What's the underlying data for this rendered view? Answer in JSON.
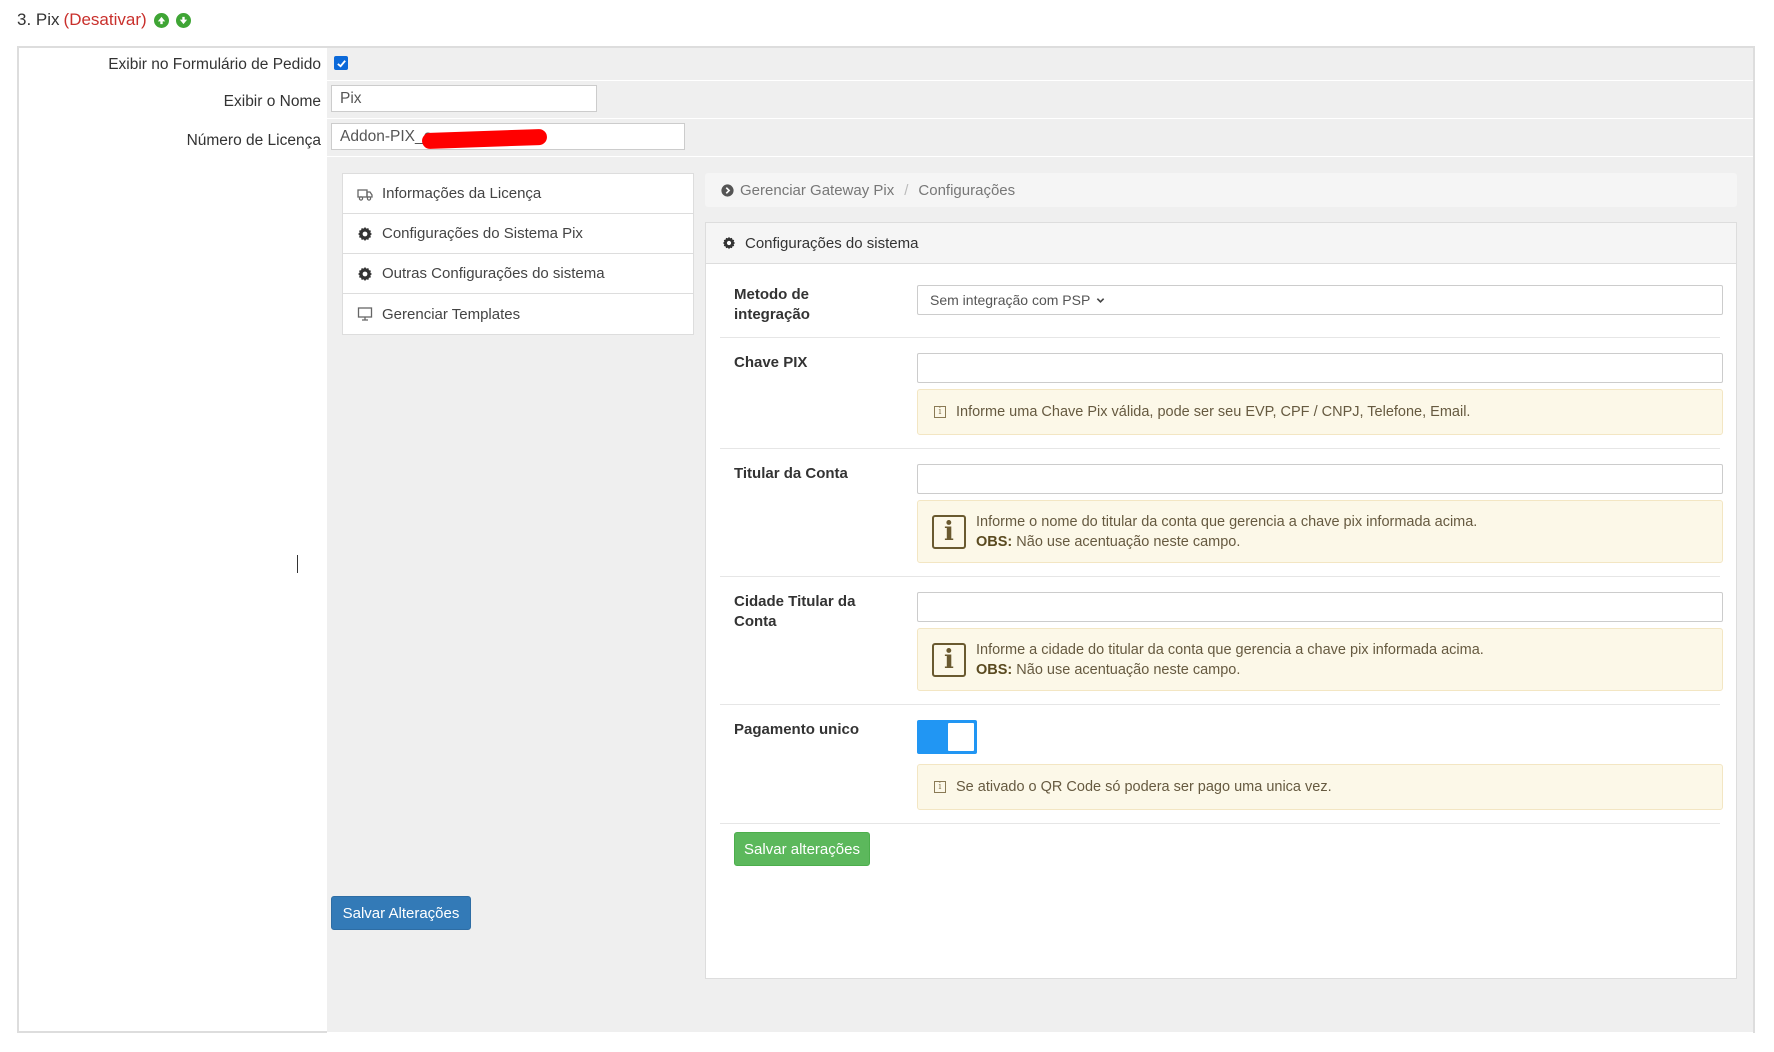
{
  "section": {
    "number_title": "3. Pix",
    "deactivate": "(Desativar)"
  },
  "form": {
    "show_on_order_label": "Exibir no Formulário de Pedido",
    "show_on_order_checked": true,
    "show_name_label": "Exibir o Nome",
    "show_name_value": "Pix",
    "license_label": "Número de Licença",
    "license_value": "Addon-PIX_e",
    "save_button": "Salvar Alterações"
  },
  "sidebar": {
    "items": [
      {
        "label": "Informações da Licença",
        "icon": "truck-icon"
      },
      {
        "label": "Configurações do Sistema Pix",
        "icon": "gear-icon"
      },
      {
        "label": "Outras Configurações do sistema",
        "icon": "gear-icon"
      },
      {
        "label": "Gerenciar Templates",
        "icon": "monitor-icon"
      }
    ]
  },
  "breadcrumb": {
    "root": "Gerenciar Gateway Pix",
    "sep": "/",
    "current": "Configurações"
  },
  "card": {
    "title": "Configurações do sistema",
    "method_label": "Metodo de integração",
    "method_value": "Sem integração com PSP",
    "pix_key_label": "Chave PIX",
    "pix_key_note": "Informe uma Chave Pix válida, pode ser seu EVP, CPF / CNPJ, Telefone, Email.",
    "holder_label": "Titular da Conta",
    "holder_note": "Informe o nome do titular da conta que gerencia a chave pix informada acima.",
    "obs_label": "OBS:",
    "obs_text": "Não use acentuação neste campo.",
    "city_label": "Cidade Titular da Conta",
    "city_note": "Informe a cidade do titular da conta que gerencia a chave pix informada acima.",
    "single_payment_label": "Pagamento unico",
    "single_payment_on": true,
    "single_payment_note": "Se ativado o QR Code só podera ser pago uma unica vez.",
    "save_button": "Salvar alterações"
  },
  "colors": {
    "accent_blue": "#337ab7",
    "accent_green": "#5cb85c",
    "danger": "#c9302c",
    "toggle": "#2196f3"
  }
}
